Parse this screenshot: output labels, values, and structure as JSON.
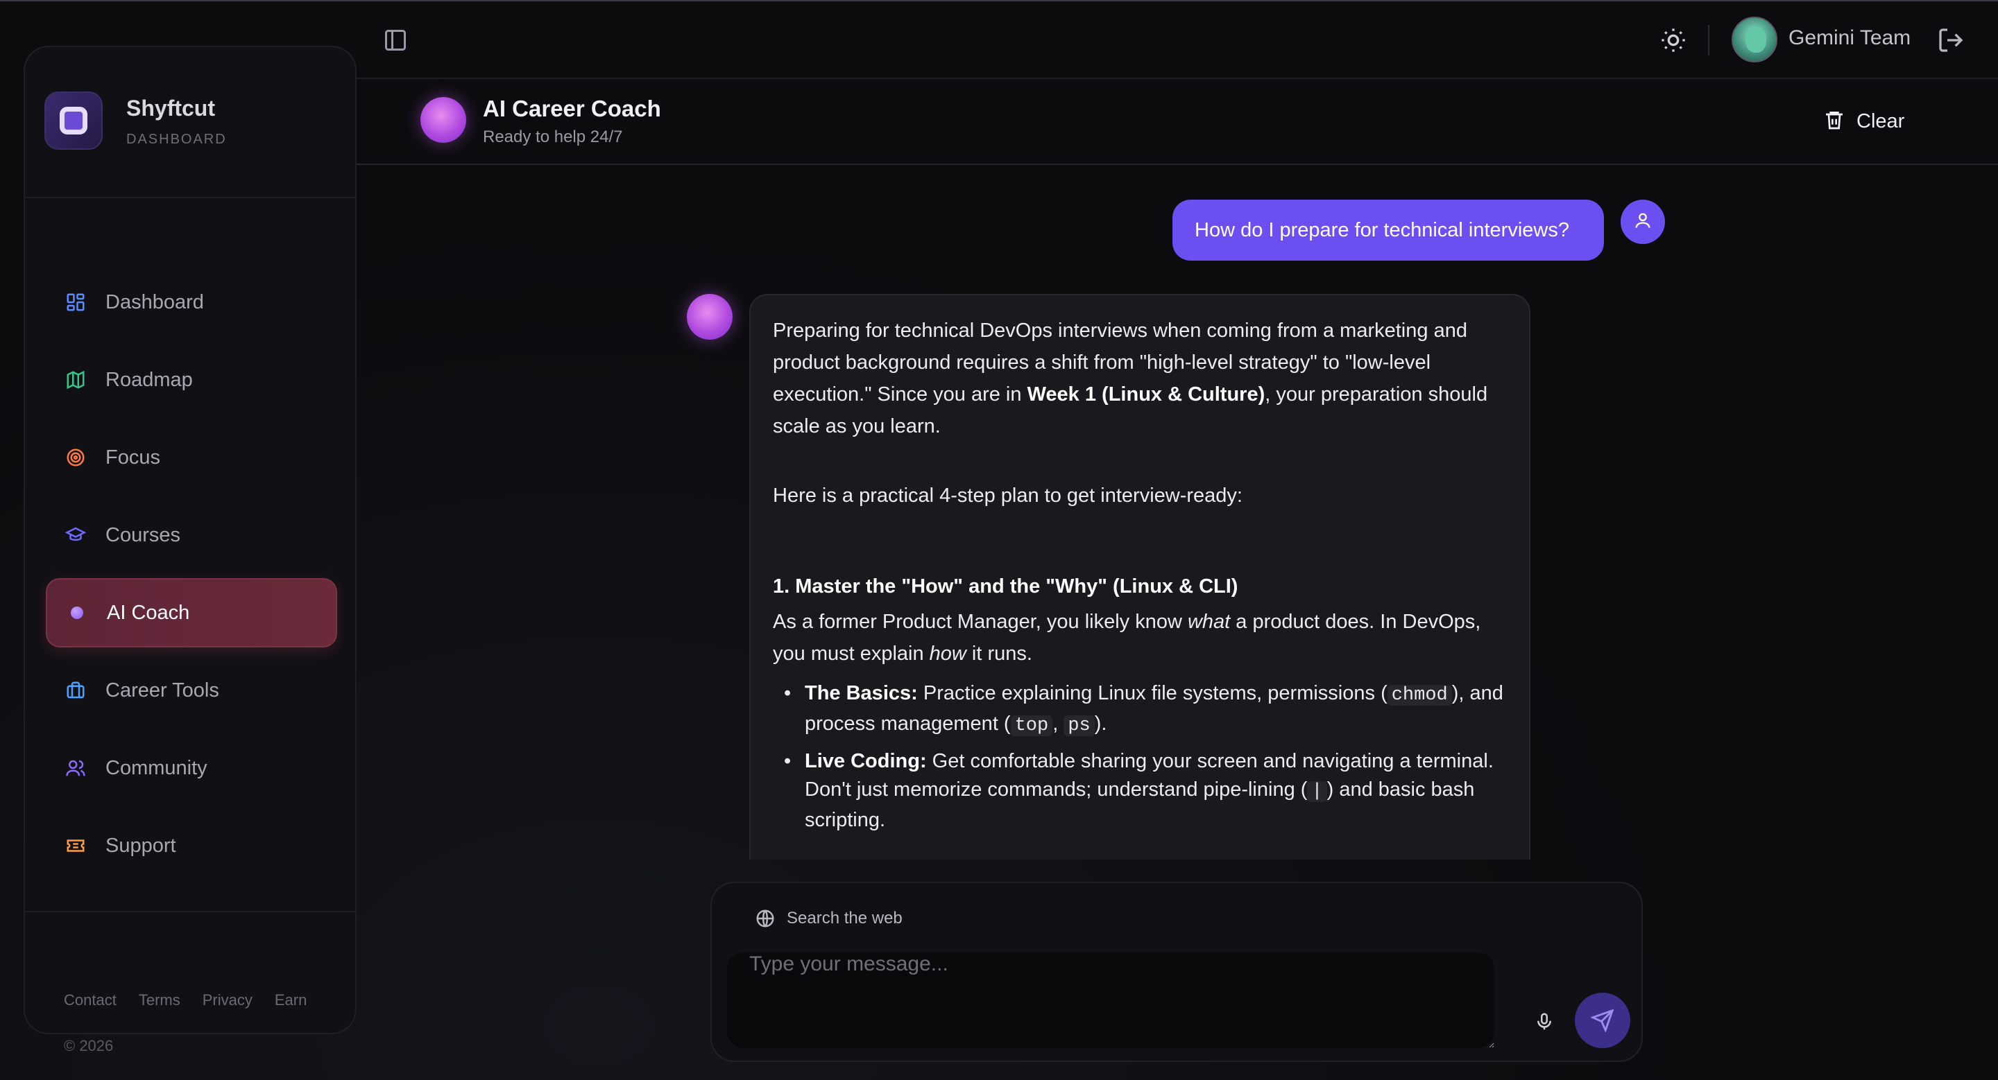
{
  "brand": {
    "name": "Shyftcut",
    "subtitle": "DASHBOARD"
  },
  "sidebar": {
    "items": [
      {
        "label": "Dashboard",
        "icon": "grid-icon",
        "color": "#5b8cff"
      },
      {
        "label": "Roadmap",
        "icon": "map-icon",
        "color": "#34c58a"
      },
      {
        "label": "Focus",
        "icon": "target-icon",
        "color": "#ff7a3d"
      },
      {
        "label": "Courses",
        "icon": "graduation-cap-icon",
        "color": "#6f6bff"
      },
      {
        "label": "AI Coach",
        "icon": "ai-dot-icon",
        "color": "#a36bff",
        "active": true
      },
      {
        "label": "Career Tools",
        "icon": "briefcase-icon",
        "color": "#4aa3ff"
      },
      {
        "label": "Community",
        "icon": "users-icon",
        "color": "#8b6bff"
      },
      {
        "label": "Support",
        "icon": "ticket-icon",
        "color": "#ff9d3d"
      }
    ],
    "footer_links": [
      "Contact",
      "Terms",
      "Privacy",
      "Earn"
    ],
    "copyright": "© 2026"
  },
  "topbar": {
    "user_name": "Gemini Team"
  },
  "chat": {
    "title": "AI Career Coach",
    "subtitle": "Ready to help 24/7",
    "clear_label": "Clear",
    "user_message": "How do I prepare for technical interviews?",
    "ai": {
      "intro_a": "Preparing for technical DevOps interviews when coming from a marketing and product background requires a shift from \"high-level strategy\" to \"low-level execution.\" Since you are in ",
      "intro_bold": "Week 1 (Linux & Culture)",
      "intro_b": ", your preparation should scale as you learn.",
      "plan": "Here is a practical 4-step plan to get interview-ready:",
      "step1_heading": "1. Master the \"How\" and the \"Why\" (Linux & CLI)",
      "step1_a": "As a former Product Manager, you likely know ",
      "step1_em1": "what",
      "step1_b": " a product does. In DevOps, you must explain ",
      "step1_em2": "how",
      "step1_c": " it runs.",
      "b1_bold": "The Basics:",
      "b1_a": " Practice explaining Linux file systems, permissions (",
      "b1_code1": "chmod",
      "b1_b": "), and process management (",
      "b1_code2": "top",
      "b1_sep": ", ",
      "b1_code3": "ps",
      "b1_c": ").",
      "b2_bold": "Live Coding:",
      "b2_a": " Get comfortable sharing your screen and navigating a terminal. Don't just memorize commands; understand pipe-lining (",
      "b2_code": "|",
      "b2_b": ") and basic bash scripting."
    }
  },
  "composer": {
    "search_web_label": "Search the web",
    "placeholder": "Type your message...",
    "value": ""
  },
  "colors": {
    "accent": "#6b4ff0",
    "active_nav": "#5e2536",
    "background": "#0c0c0f"
  }
}
